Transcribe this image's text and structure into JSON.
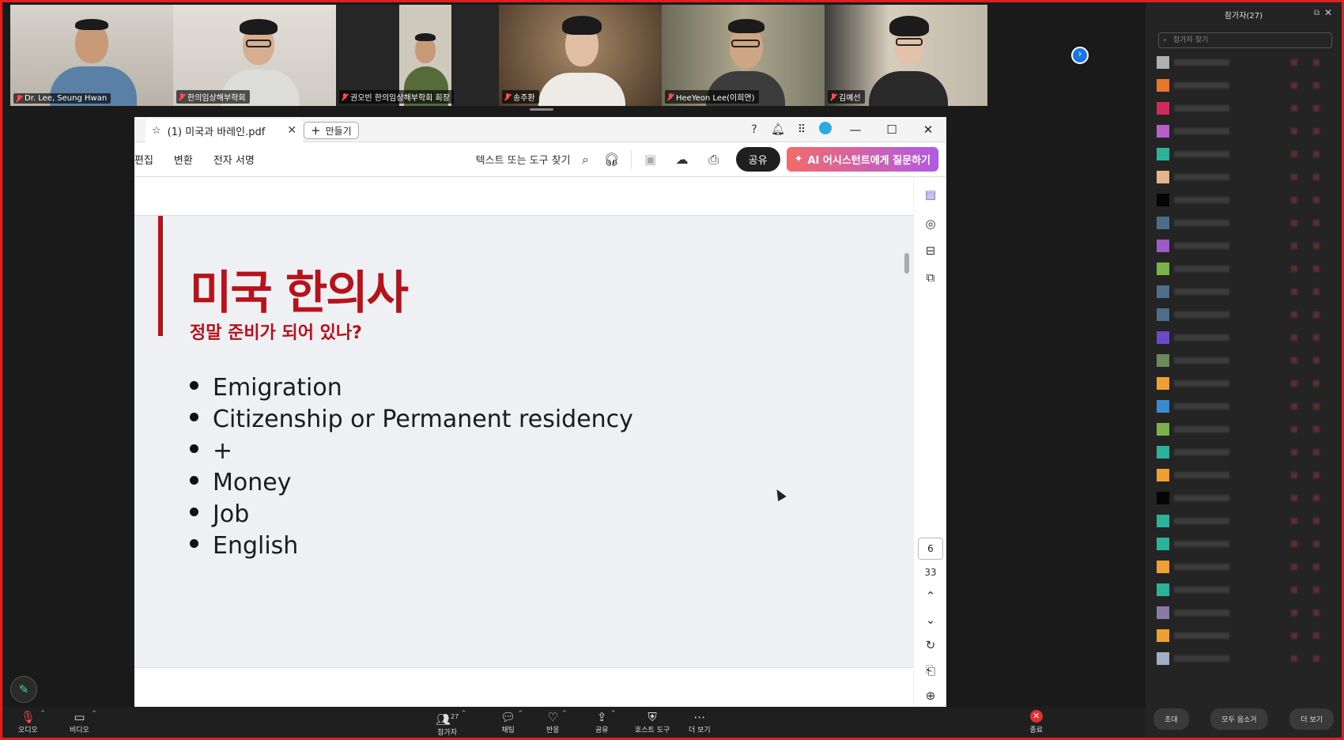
{
  "video_strip": {
    "tiles": [
      {
        "name": "Dr. Lee, Seung Hwan",
        "bg": "#c9c6bf",
        "shirt": "#5a80a8"
      },
      {
        "name": "한의임상해부학회",
        "bg": "#d8d4ce",
        "shirt": "#d9d9d6"
      },
      {
        "name": "권오빈 한의임상해부학회 회장",
        "bg": "#2d2d2d",
        "shirt": "#556b3a"
      },
      {
        "name": "송주환",
        "bg": "#8b6a4a",
        "shirt": "#eeeae6"
      },
      {
        "name": "HeeYeon Lee(이희연)",
        "bg": "#7c7a66",
        "shirt": "#3c3c3c"
      },
      {
        "name": "김예선",
        "bg": "#b9b1a4",
        "shirt": "#2a2a2a"
      }
    ]
  },
  "acrobat": {
    "tab_title": "(1) 미국과 바레인.pdf",
    "new_tab_label": "만들기",
    "menu": [
      "편집",
      "변환",
      "전자 서명"
    ],
    "search_label": "텍스트 또는 도구 찾기",
    "share_label": "공유",
    "ai_label": "AI 어시스턴트에게 질문하기",
    "current_page": "6",
    "total_pages": "33"
  },
  "slide": {
    "title": "미국 한의사",
    "subtitle": "정말 준비가 되어 있나?",
    "bullets": [
      "Emigration",
      "Citizenship or Permanent residency",
      "+",
      "Money",
      "Job",
      "English"
    ]
  },
  "participants_panel": {
    "title": "참가자(27)",
    "search_placeholder": "참가자 찾기",
    "avatar_colors": [
      "#b0b0b0",
      "#e8772a",
      "#d1285e",
      "#b560c8",
      "#2bb39a",
      "#e8b48a",
      "#050505",
      "#4d6d8a",
      "#a05ac8",
      "#7cb048",
      "#4d6d8a",
      "#4d6d8a",
      "#6a4ac8",
      "#6d8a5a",
      "#f0a030",
      "#3a8ad0",
      "#7cb048",
      "#2bb39a",
      "#f0a030",
      "#050505",
      "#2bb39a",
      "#2bb39a",
      "#f0a030",
      "#2bb39a",
      "#8a7aa8",
      "#f0a030",
      "#a0b0c0"
    ],
    "footer_buttons": [
      "초대",
      "모두 음소거",
      "더 보기"
    ]
  },
  "meeting_bar": {
    "audio": "오디오",
    "video": "비디오",
    "participants": "참가자",
    "participant_count": "27",
    "chat": "채팅",
    "reaction": "반응",
    "share": "공유",
    "host_tools": "호스트 도구",
    "more": "더 보기",
    "end": "종료"
  }
}
